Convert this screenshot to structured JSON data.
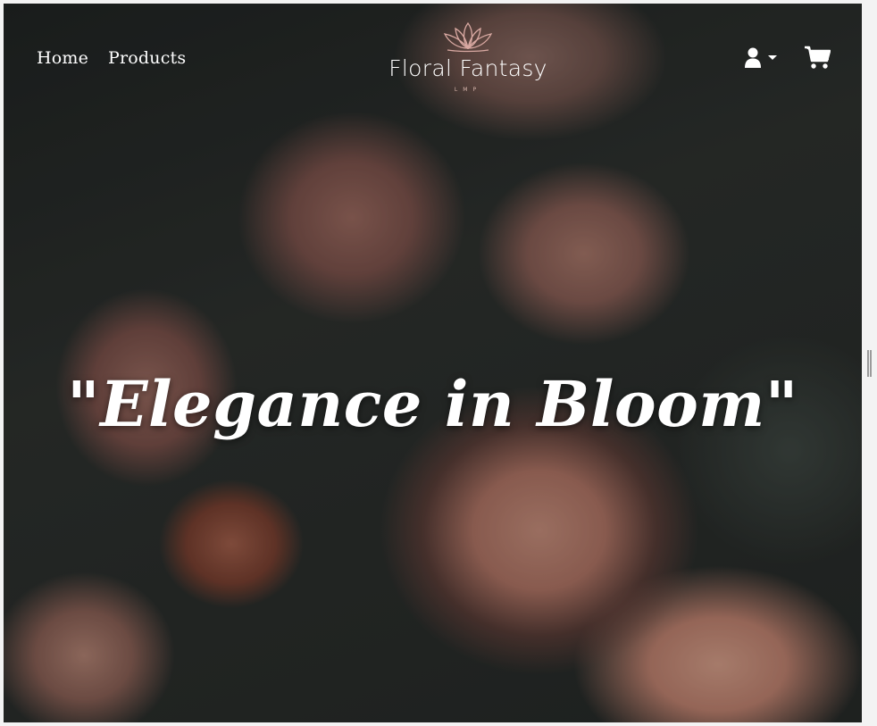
{
  "nav": {
    "links": [
      {
        "label": "Home"
      },
      {
        "label": "Products"
      }
    ]
  },
  "brand": {
    "name": "Floral Fantasy",
    "subtitle": "LMP"
  },
  "icons": {
    "user": "user-icon",
    "dropdown": "caret-down-icon",
    "cart": "shopping-cart-icon",
    "logo": "lotus-logo"
  },
  "hero": {
    "quote": "\"Elegance in Bloom\""
  },
  "colors": {
    "nav_text": "#ffffff",
    "logo_accent": "#d8b7ae"
  }
}
